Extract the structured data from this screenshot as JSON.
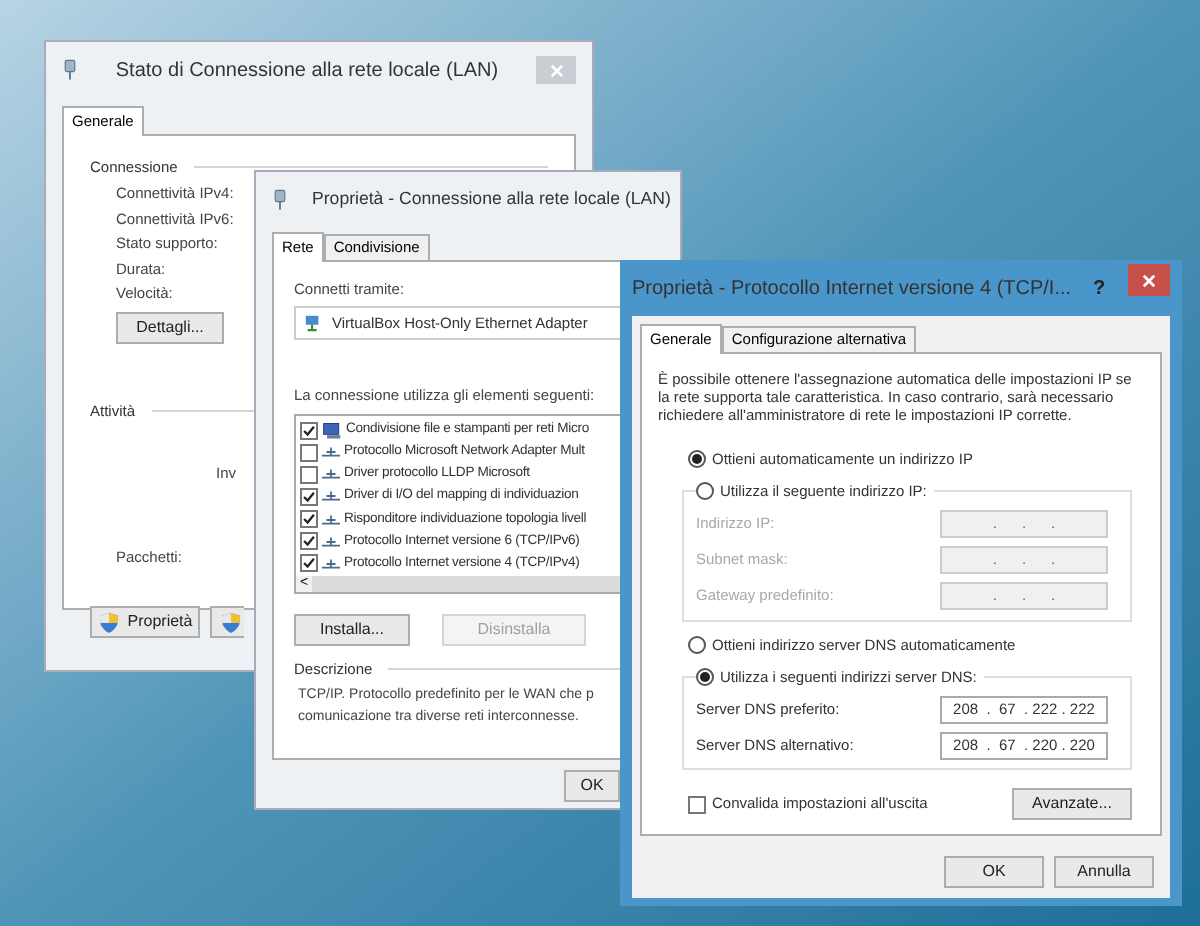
{
  "status_window": {
    "title": "Stato di Connessione alla rete locale (LAN)",
    "active": false,
    "tabs": [
      {
        "label": "Generale",
        "selected": true
      }
    ],
    "connection_group": {
      "title": "Connessione",
      "labels": [
        "Connettività IPv4:",
        "Connettività IPv6:",
        "Stato supporto:",
        "Durata:",
        "Velocità:"
      ]
    },
    "details_button": "Dettagli...",
    "activity_group": {
      "title": "Attività",
      "column_1": "Inv",
      "packets_label": "Pacchetti:"
    },
    "properties_button": "Proprietà"
  },
  "properties_window": {
    "title": "Proprietà - Connessione alla rete locale (LAN)",
    "active": false,
    "tabs": [
      {
        "label": "Rete",
        "selected": true
      },
      {
        "label": "Condivisione",
        "selected": false
      }
    ],
    "connect_via_label": "Connetti tramite:",
    "adapter": "VirtualBox Host-Only Ethernet Adapter",
    "items_label": "La connessione utilizza gli elementi seguenti:",
    "items": [
      {
        "kind": "service",
        "label": "Condivisione file e stampanti per reti Micro",
        "checked": true
      },
      {
        "kind": "protocol",
        "label": "Protocollo Microsoft Network Adapter Mult",
        "checked": false
      },
      {
        "kind": "protocol",
        "label": "Driver protocollo LLDP Microsoft",
        "checked": false
      },
      {
        "kind": "protocol",
        "label": "Driver di I/O del mapping di individuazion",
        "checked": true
      },
      {
        "kind": "protocol",
        "label": "Risponditore individuazione topologia livell",
        "checked": true
      },
      {
        "kind": "protocol",
        "label": "Protocollo Internet versione 6 (TCP/IPv6)",
        "checked": true
      },
      {
        "kind": "protocol",
        "label": "Protocollo Internet versione 4 (TCP/IPv4)",
        "checked": true
      }
    ],
    "scroll_left": "<",
    "buttons": [
      {
        "label": "Installa...",
        "disabled": false
      },
      {
        "label": "Disinstalla",
        "disabled": true
      }
    ],
    "description": {
      "title": "Descrizione",
      "lines": [
        "TCP/IP. Protocollo predefinito per le WAN che p",
        "comunicazione tra diverse reti interconnesse."
      ]
    },
    "ok_button": "OK"
  },
  "ipv4_window": {
    "title": "Proprietà - Protocollo Internet versione 4 (TCP/I...",
    "active": true,
    "help_button": "?",
    "tabs": [
      {
        "label": "Generale",
        "selected": true
      },
      {
        "label": "Configurazione alternativa",
        "selected": false
      }
    ],
    "intro": "È possibile ottenere l'assegnazione automatica delle impostazioni IP se la rete supporta tale caratteristica. In caso contrario, sarà necessario richiedere all'amministratore di rete le impostazioni IP corrette.",
    "ip_mode": [
      {
        "label": "Ottieni automaticamente un indirizzo IP",
        "selected": true
      },
      {
        "label": "Utilizza il seguente indirizzo IP:",
        "selected": false
      }
    ],
    "ip_fields": [
      {
        "label": "Indirizzo IP:",
        "value": ".      .      .",
        "disabled": true
      },
      {
        "label": "Subnet mask:",
        "value": ".      .      .",
        "disabled": true
      },
      {
        "label": "Gateway predefinito:",
        "value": ".      .      .",
        "disabled": true
      }
    ],
    "dns_mode": [
      {
        "label": "Ottieni indirizzo server DNS automaticamente",
        "selected": false
      },
      {
        "label": "Utilizza i seguenti indirizzi server DNS:",
        "selected": true
      }
    ],
    "dns_fields": [
      {
        "label": "Server DNS preferito:",
        "value": "208  .  67  . 222 . 222",
        "disabled": false
      },
      {
        "label": "Server DNS alternativo:",
        "value": "208  .  67  . 220 . 220",
        "disabled": false
      }
    ],
    "validate": {
      "label": "Convalida impostazioni all'uscita",
      "checked": false
    },
    "advanced_button": "Avanzate...",
    "buttons": [
      "OK",
      "Annulla"
    ]
  }
}
